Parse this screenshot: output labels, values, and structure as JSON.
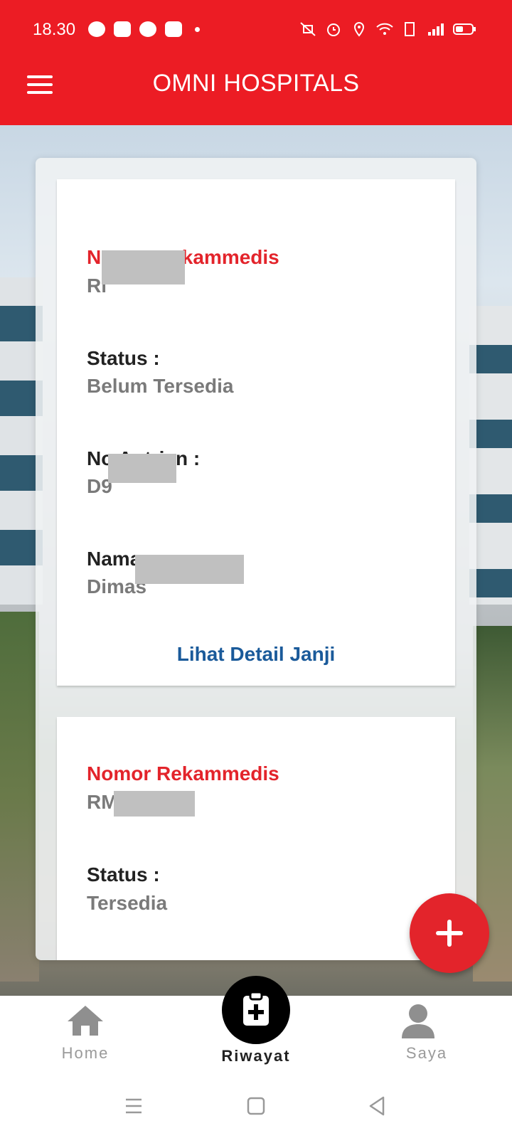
{
  "status_bar": {
    "time": "18.30"
  },
  "app_bar": {
    "title": "OMNI HOSPITALS"
  },
  "cards": [
    {
      "rm_label": "Nomor Rekammedis",
      "rm_value": "Rl",
      "status_label": "Status :",
      "status_value": "Belum Tersedia",
      "queue_label": "No Antrian :",
      "queue_value": "D9",
      "name_label": "Nama :",
      "name_value": "Dimas",
      "detail_link": "Lihat Detail Janji"
    },
    {
      "rm_label": "Nomor Rekammedis",
      "rm_value": "RM",
      "status_label": "Status :",
      "status_value": "Tersedia"
    }
  ],
  "bottom_nav": {
    "home": "Home",
    "riwayat": "Riwayat",
    "saya": "Saya",
    "active": "Riwayat"
  },
  "colors": {
    "primary_red": "#ec1c24",
    "link_blue": "#1a5a9a",
    "value_gray": "#7a7a7a"
  },
  "icons": [
    "menu-icon",
    "plus-icon",
    "home-icon",
    "clipboard-medical-icon",
    "person-icon",
    "recents-icon",
    "home-square-icon",
    "back-icon"
  ]
}
